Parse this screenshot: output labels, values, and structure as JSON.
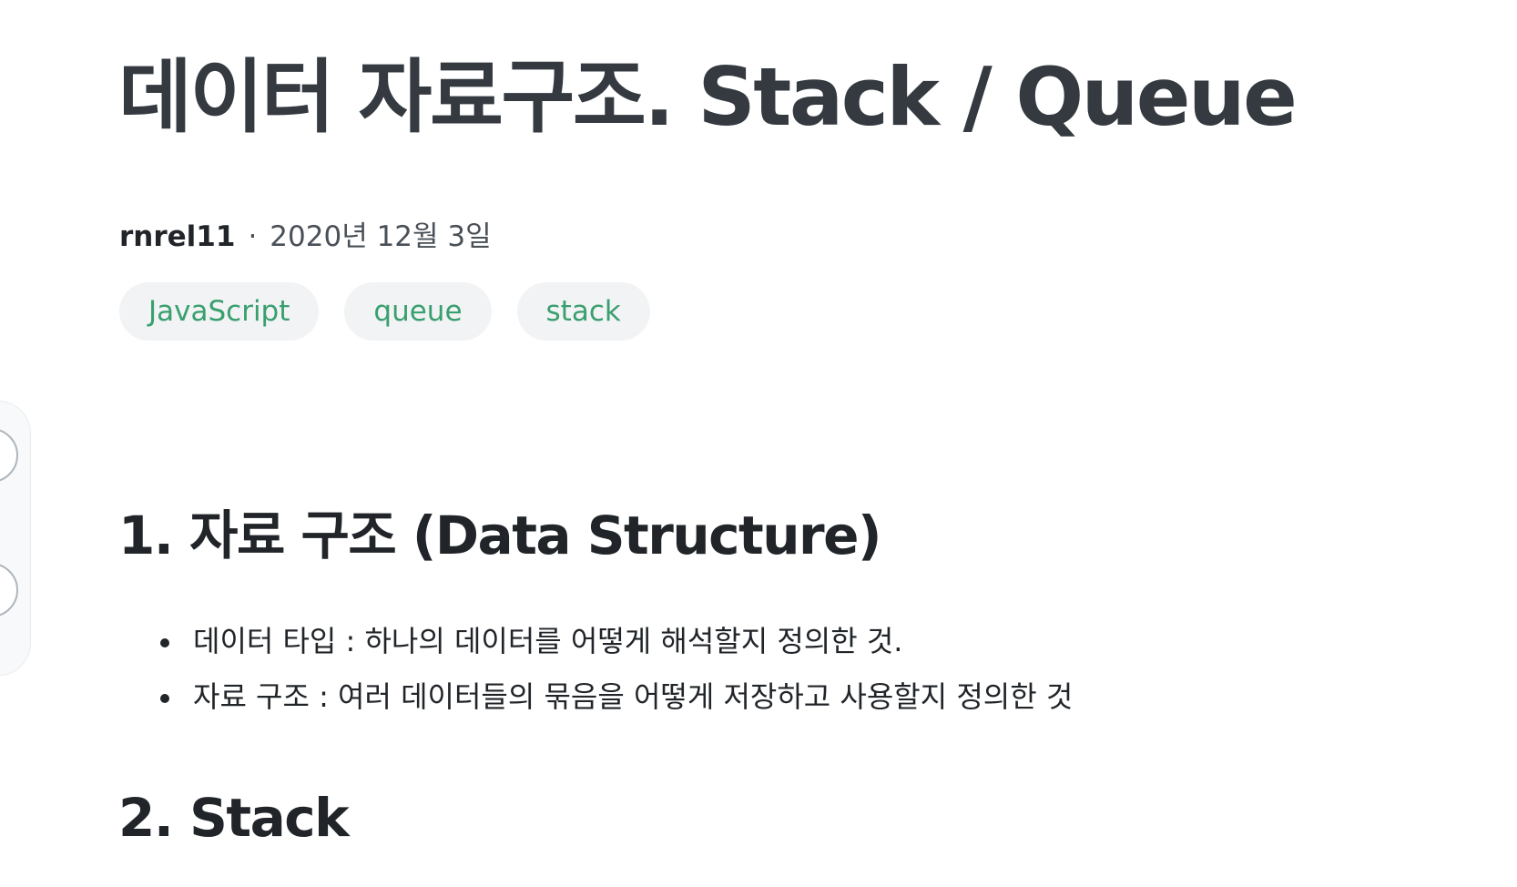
{
  "post": {
    "title": "데이터 자료구조. Stack / Queue",
    "author": "rnrel11",
    "separator": "·",
    "date": "2020년 12월 3일",
    "tags": [
      "JavaScript",
      "queue",
      "stack"
    ]
  },
  "content": {
    "section1": {
      "heading": "1. 자료 구조 (Data Structure)",
      "bullets": [
        "데이터 타입 : 하나의 데이터를 어떻게 해석할지 정의한 것.",
        "자료 구조 : 여러 데이터들의 묶음을 어떻게 저장하고 사용할지 정의한 것"
      ]
    },
    "section2": {
      "heading": "2. Stack"
    }
  },
  "colors": {
    "title": "#343a40",
    "tag_text": "#3a9f6e",
    "tag_bg": "#f1f3f5",
    "body_text": "#212529"
  }
}
